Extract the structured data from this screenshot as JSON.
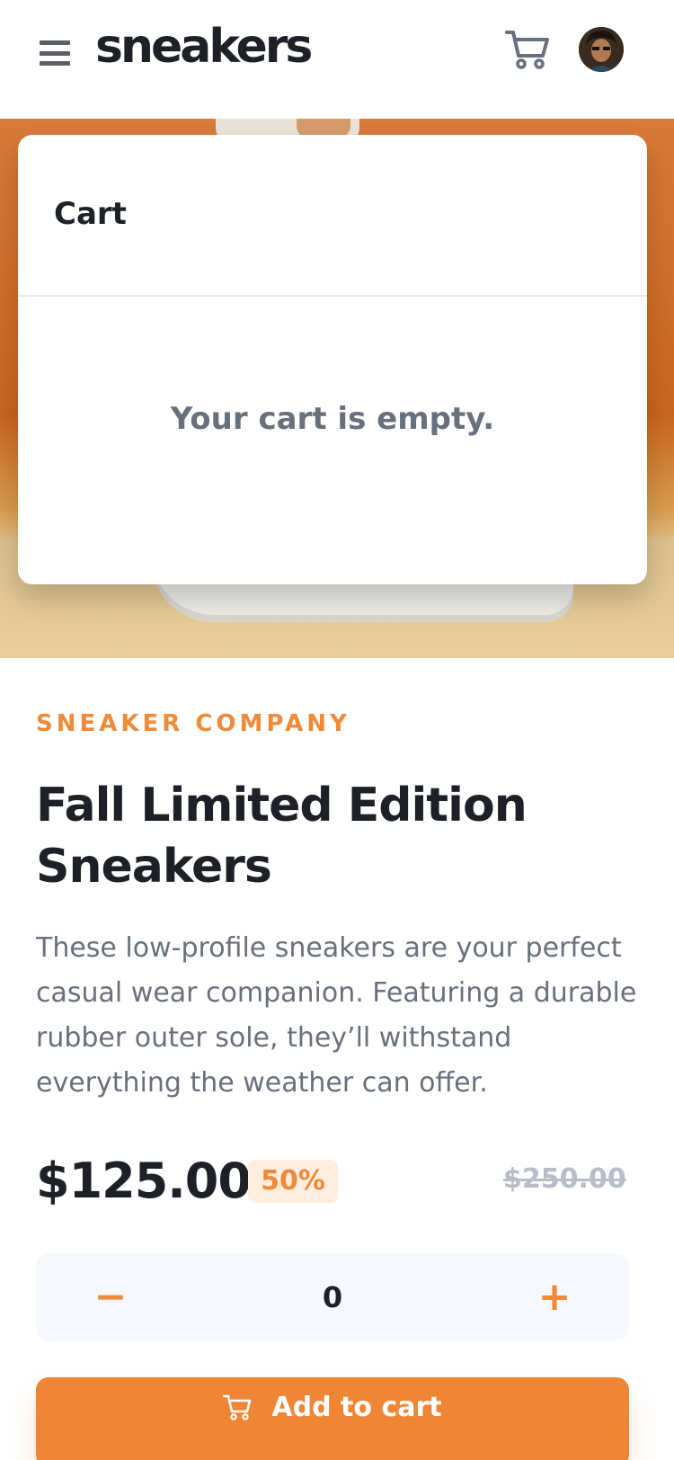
{
  "header": {
    "logo": "sneakers",
    "menu_icon": "menu-icon",
    "cart_icon": "cart-icon",
    "avatar": "avatar"
  },
  "cart": {
    "title": "Cart",
    "empty_message": "Your cart is empty."
  },
  "product": {
    "company": "SNEAKER COMPANY",
    "title": "Fall Limited Edition Sneakers",
    "description": "These low-profile sneakers are your perfect casual wear companion. Featuring a durable rubber outer sole, they’ll withstand everything the weather can offer.",
    "price": "$125.00",
    "discount": "50%",
    "original_price": "$250.00"
  },
  "quantity": {
    "minus_label": "−",
    "value": "0",
    "plus_label": "+"
  },
  "add_to_cart": {
    "label": "Add to cart",
    "icon": "cart-icon"
  },
  "colors": {
    "accent": "#ee8a38",
    "text_dark": "#1d2026",
    "text_muted": "#69707d",
    "discount_bg": "#ffede0",
    "stepper_bg": "#f6f8fd"
  }
}
